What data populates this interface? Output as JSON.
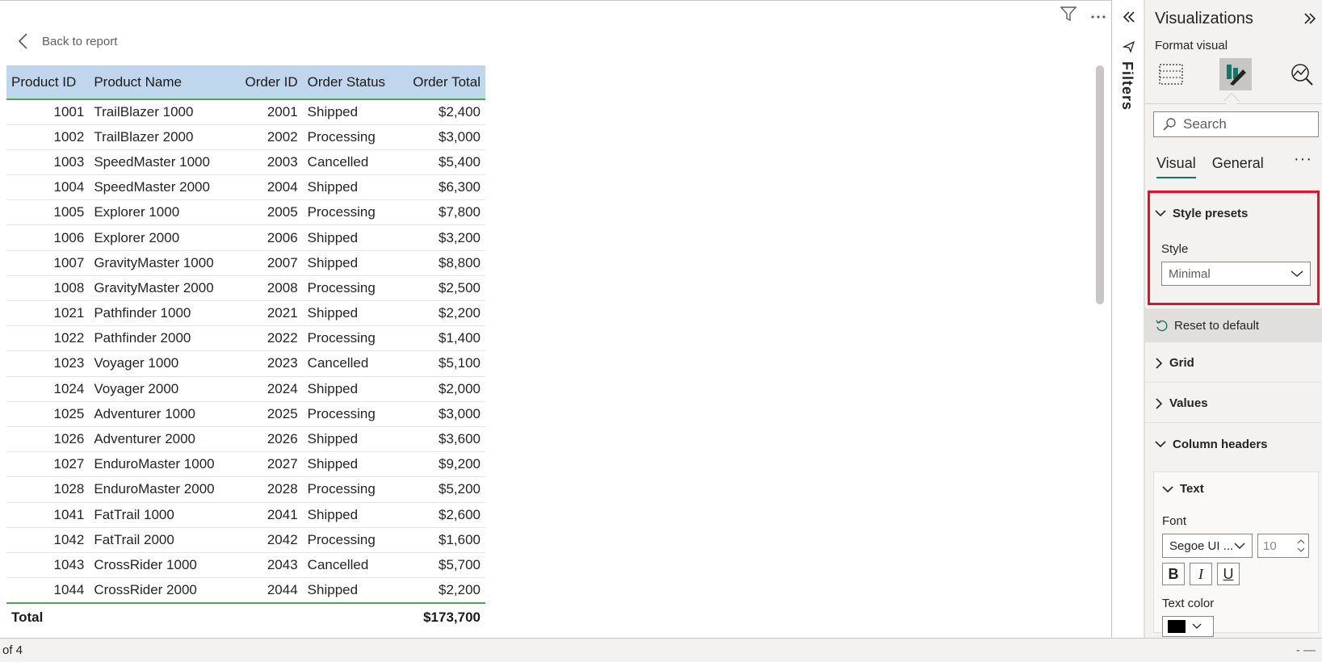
{
  "report": {
    "back_label": "Back to report"
  },
  "table": {
    "headers": [
      "Product ID",
      "Product Name",
      "Order ID",
      "Order Status",
      "Order Total"
    ],
    "rows": [
      [
        "1001",
        "TrailBlazer 1000",
        "2001",
        "Shipped",
        "$2,400"
      ],
      [
        "1002",
        "TrailBlazer 2000",
        "2002",
        "Processing",
        "$3,000"
      ],
      [
        "1003",
        "SpeedMaster 1000",
        "2003",
        "Cancelled",
        "$5,400"
      ],
      [
        "1004",
        "SpeedMaster 2000",
        "2004",
        "Shipped",
        "$6,300"
      ],
      [
        "1005",
        "Explorer 1000",
        "2005",
        "Processing",
        "$7,800"
      ],
      [
        "1006",
        "Explorer 2000",
        "2006",
        "Shipped",
        "$3,200"
      ],
      [
        "1007",
        "GravityMaster 1000",
        "2007",
        "Shipped",
        "$8,800"
      ],
      [
        "1008",
        "GravityMaster 2000",
        "2008",
        "Processing",
        "$2,500"
      ],
      [
        "1021",
        "Pathfinder 1000",
        "2021",
        "Shipped",
        "$2,200"
      ],
      [
        "1022",
        "Pathfinder 2000",
        "2022",
        "Processing",
        "$1,400"
      ],
      [
        "1023",
        "Voyager 1000",
        "2023",
        "Cancelled",
        "$5,100"
      ],
      [
        "1024",
        "Voyager 2000",
        "2024",
        "Shipped",
        "$2,000"
      ],
      [
        "1025",
        "Adventurer 1000",
        "2025",
        "Processing",
        "$3,000"
      ],
      [
        "1026",
        "Adventurer 2000",
        "2026",
        "Shipped",
        "$3,600"
      ],
      [
        "1027",
        "EnduroMaster 1000",
        "2027",
        "Shipped",
        "$9,200"
      ],
      [
        "1028",
        "EnduroMaster 2000",
        "2028",
        "Processing",
        "$5,200"
      ],
      [
        "1041",
        "FatTrail 1000",
        "2041",
        "Shipped",
        "$2,600"
      ],
      [
        "1042",
        "FatTrail 2000",
        "2042",
        "Processing",
        "$1,600"
      ],
      [
        "1043",
        "CrossRider 1000",
        "2043",
        "Cancelled",
        "$5,700"
      ],
      [
        "1044",
        "CrossRider 2000",
        "2044",
        "Shipped",
        "$2,200"
      ]
    ],
    "total_label": "Total",
    "total_value": "$173,700"
  },
  "filters": {
    "label": "Filters"
  },
  "viz_pane": {
    "title": "Visualizations",
    "subtitle": "Format visual",
    "search_placeholder": "Search",
    "tabs": [
      "Visual",
      "General"
    ],
    "more_label": "···",
    "sections": {
      "style_presets": "Style presets",
      "style_label": "Style",
      "style_value": "Minimal",
      "reset": "Reset to default",
      "grid": "Grid",
      "values": "Values",
      "column_headers": "Column headers",
      "text": "Text",
      "font_label": "Font",
      "font_value": "Segoe UI ...",
      "font_size": "10",
      "bold": "B",
      "italic": "I",
      "underline": "U",
      "text_color": "Text color"
    }
  },
  "status_bar": {
    "page_info": "of 4",
    "zoom": "- —"
  },
  "colors": {
    "header_bg": "#c0d6ec",
    "accent_green": "#4fa35a",
    "highlight_red": "#e81123",
    "tab_underline": "#117865"
  }
}
